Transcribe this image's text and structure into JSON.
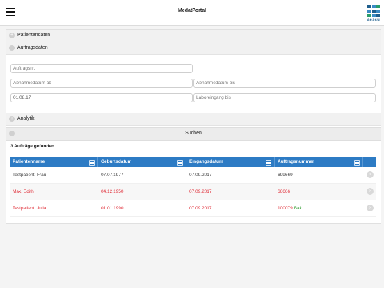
{
  "app": {
    "title": "MedatPortal",
    "logo_text": "aescu"
  },
  "colors": {
    "accent": "#2d7bc4",
    "alert": "#e0303a",
    "ok": "#3aa03a"
  },
  "sections": {
    "patient": {
      "label": "Patientendaten",
      "icon": "plus-circle-icon"
    },
    "order": {
      "label": "Auftragsdaten",
      "icon": "minus-circle-icon"
    },
    "analytics": {
      "label": "Analytik",
      "icon": "plus-circle-icon"
    }
  },
  "form": {
    "order_no": {
      "placeholder": "Auftragsnr.",
      "value": ""
    },
    "collect_from": {
      "placeholder": "Abnahmedatum ab",
      "value": ""
    },
    "collect_to": {
      "placeholder": "Abnahmedatum bis",
      "value": ""
    },
    "lab_received_from": {
      "placeholder": "",
      "value": "01.08.17"
    },
    "lab_received_to": {
      "placeholder": "Laboreingang bis",
      "value": ""
    }
  },
  "search": {
    "label": "Suchen"
  },
  "results": {
    "count_text": "3 Aufträge gefunden",
    "columns": [
      "Patientenname",
      "Geburtsdatum",
      "Eingangsdatum",
      "Auftragsnummer"
    ],
    "rows": [
      {
        "name": "Testpatient, Frau",
        "dob": "07.07.1977",
        "received": "07.09.2017",
        "order": "699669",
        "flag": "",
        "status": "normal"
      },
      {
        "name": "Max, Edith",
        "dob": "04.12.1950",
        "received": "07.09.2017",
        "order": "66666",
        "flag": "",
        "status": "alert"
      },
      {
        "name": "Testpatient, Julia",
        "dob": "01.01.1990",
        "received": "07.09.2017",
        "order": "100079",
        "flag": "Bak",
        "status": "alert"
      }
    ]
  }
}
